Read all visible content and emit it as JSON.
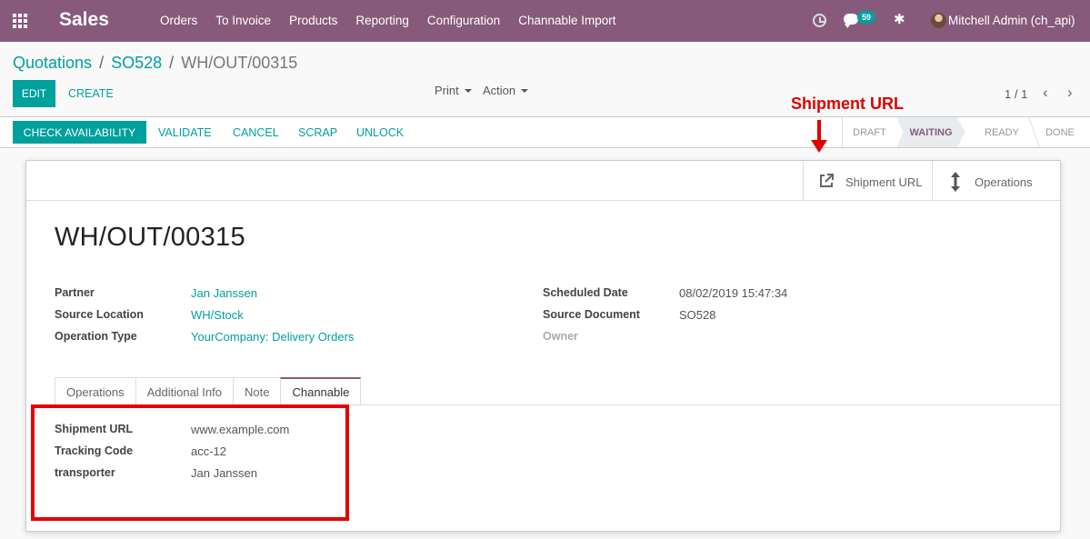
{
  "navbar": {
    "app_name": "Sales",
    "menu": [
      "Orders",
      "To Invoice",
      "Products",
      "Reporting",
      "Configuration",
      "Channable Import"
    ],
    "messages_count": "59",
    "user": "Mitchell Admin (ch_api)",
    "color": "#875a7b"
  },
  "breadcrumb": {
    "items": [
      "Quotations",
      "SO528"
    ],
    "current": "WH/OUT/00315"
  },
  "control": {
    "edit": "EDIT",
    "create": "CREATE",
    "print": "Print",
    "action": "Action",
    "pager": "1 / 1"
  },
  "header": {
    "buttons": [
      "CHECK AVAILABILITY",
      "VALIDATE",
      "CANCEL",
      "SCRAP",
      "UNLOCK"
    ],
    "states": [
      "DRAFT",
      "WAITING",
      "READY",
      "DONE"
    ],
    "active_state": "WAITING"
  },
  "annotation": {
    "label": "Shipment URL",
    "color": "#e00000"
  },
  "sheet": {
    "stat_buttons": [
      {
        "label": "Shipment URL",
        "icon": "external-link-icon"
      },
      {
        "label": "Operations",
        "icon": "arrows-v-icon"
      }
    ],
    "title": "WH/OUT/00315",
    "left_fields": [
      {
        "label": "Partner",
        "value": "Jan Janssen"
      },
      {
        "label": "Source Location",
        "value": "WH/Stock"
      },
      {
        "label": "Operation Type",
        "value": "YourCompany: Delivery Orders"
      }
    ],
    "right_fields": [
      {
        "label": "Scheduled Date",
        "value": "08/02/2019 15:47:34"
      },
      {
        "label": "Source Document",
        "value": "SO528"
      },
      {
        "label": "Owner",
        "value": ""
      }
    ],
    "tabs": [
      "Operations",
      "Additional Info",
      "Note",
      "Channable"
    ],
    "active_tab": "Channable",
    "channable_fields": [
      {
        "label": "Shipment URL",
        "value": "www.example.com"
      },
      {
        "label": "Tracking Code",
        "value": "acc-12"
      },
      {
        "label": "transporter",
        "value": "Jan Janssen"
      }
    ]
  }
}
